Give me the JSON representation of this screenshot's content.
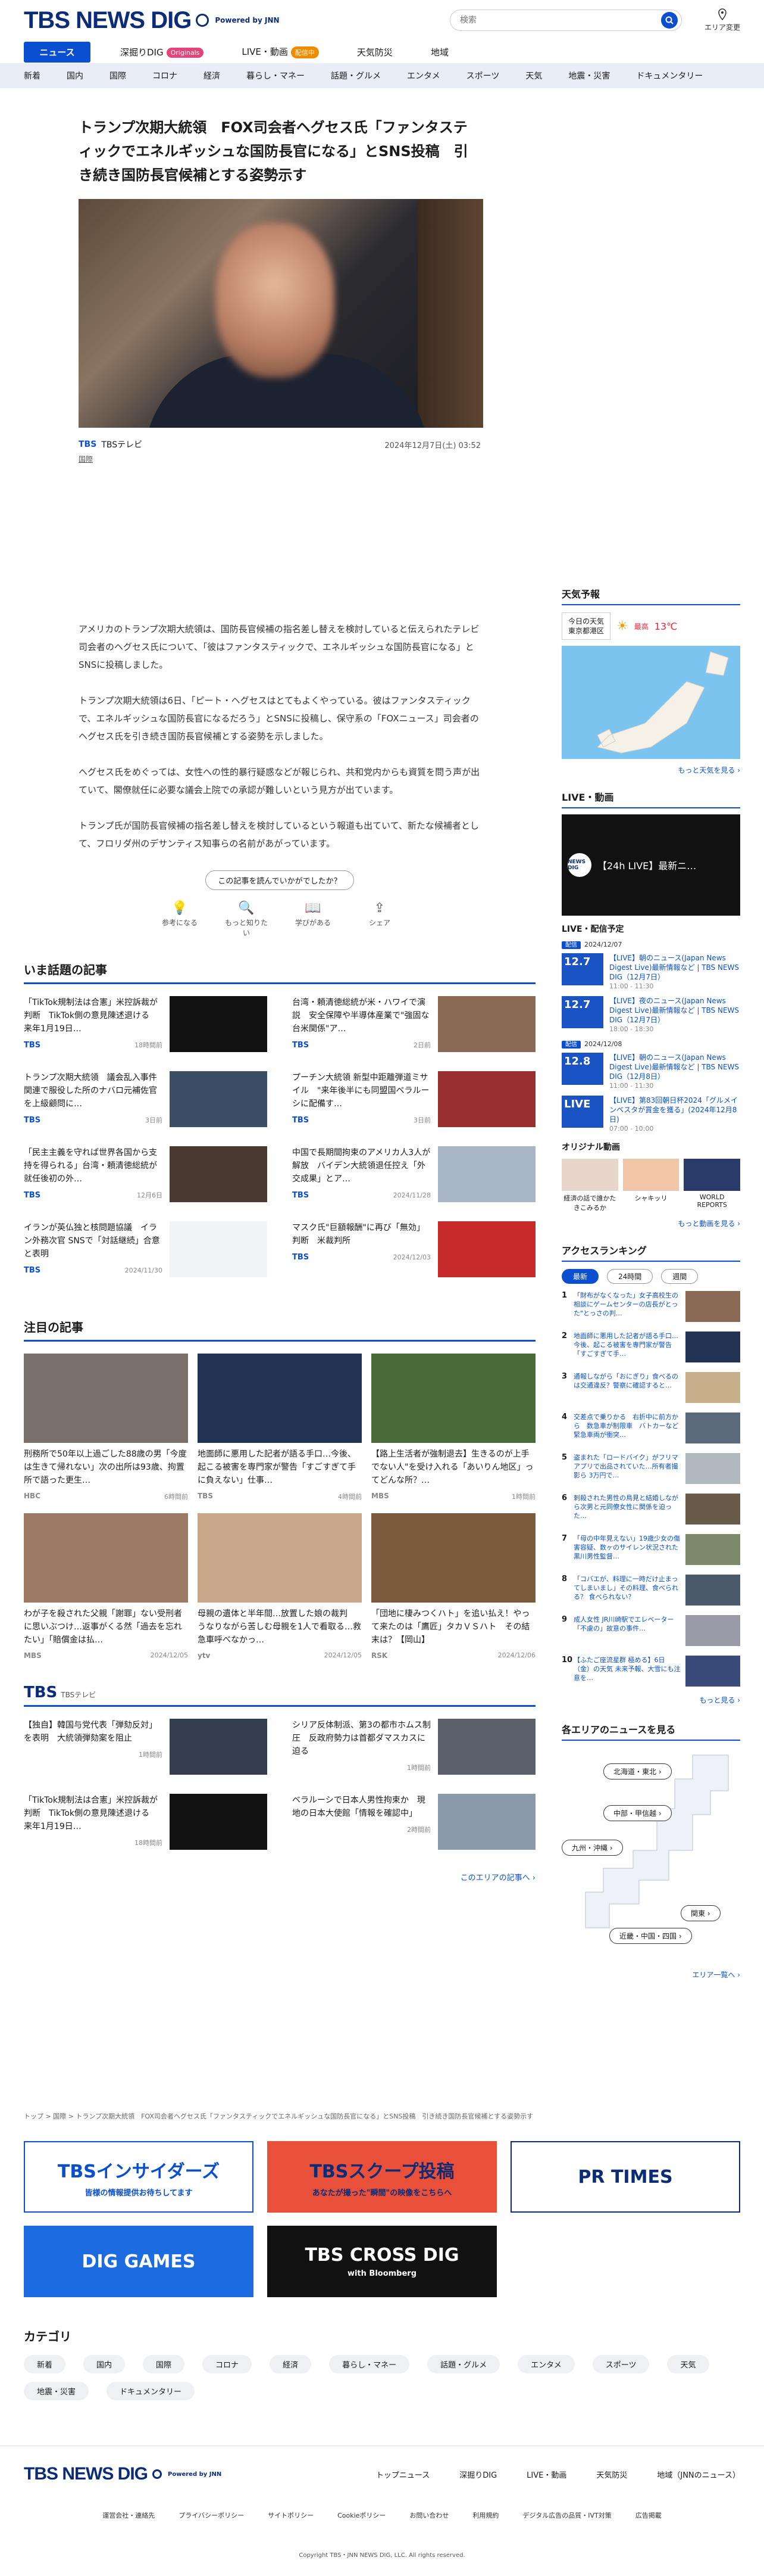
{
  "header": {
    "logo_text": "TBS NEWS DIG",
    "powered": "Powered by JNN",
    "search_placeholder": "検索",
    "area_label": "エリア変更"
  },
  "nav": [
    {
      "label": "ニュース",
      "active": true
    },
    {
      "label": "深掘りDIG",
      "badge": "Originals"
    },
    {
      "label": "LIVE・動画",
      "badge": "配信中"
    },
    {
      "label": "天気防災"
    },
    {
      "label": "地域"
    }
  ],
  "categories": [
    "新着",
    "国内",
    "国際",
    "コロナ",
    "経済",
    "暮らし・マネー",
    "話題・グルメ",
    "エンタメ",
    "スポーツ",
    "天気",
    "地震・災害",
    "ドキュメンタリー"
  ],
  "article": {
    "title": "トランプ次期大統領　FOX司会者ヘグセス氏「ファンタスティックでエネルギッシュな国防長官になる」とSNS投稿　引き続き国防長官候補とする姿勢示す",
    "source_logo": "TBS",
    "source": "TBSテレビ",
    "date": "2024年12月7日(土) 03:52",
    "tag": "国際",
    "paragraphs": [
      "アメリカのトランプ次期大統領は、国防長官候補の指名差し替えを検討していると伝えられたテレビ司会者のヘグセス氏について、「彼はファンタスティックで、エネルギッシュな国防長官になる」とSNSに投稿しました。",
      "トランプ次期大統領は6日、「ピート・ヘグセスはとてもよくやっている。彼はファンタスティックで、エネルギッシュな国防長官になるだろう」とSNSに投稿し、保守系の「FOXニュース」司会者のヘグセス氏を引き続き国防長官候補とする姿勢を示しました。",
      "ヘグセス氏をめぐっては、女性への性的暴行疑惑などが報じられ、共和党内からも資質を問う声が出ていて、閣僚就任に必要な議会上院での承認が難しいという見方が出ています。",
      "トランプ氏が国防長官候補の指名差し替えを検討しているという報道も出ていて、新たな候補者として、フロリダ州のデサンティス知事らの名前があがっています。"
    ],
    "feedback_prompt": "この記事を読んでいかがでしたか？",
    "reactions": [
      "参考になる",
      "もっと知りたい",
      "学びがある",
      "シェア"
    ]
  },
  "trending": {
    "title": "いま話題の記事",
    "items": [
      {
        "text": "「TikTok規制法は合憲」米控訴裁が判断　TikTok側の意見陳述退ける　来年1月19日…",
        "src": "TBS",
        "time": "18時間前",
        "color": "#111111"
      },
      {
        "text": "台湾・頼清徳総統が米・ハワイで演説　安全保障や半導体産業で\"強固な台米関係\"ア…",
        "src": "TBS",
        "time": "2日前",
        "color": "#8a6a55"
      },
      {
        "text": "トランプ次期大統領　議会乱入事件関連で服役した所のナバロ元補佐官を上級顧問に…",
        "src": "TBS",
        "time": "3日前",
        "color": "#3c4d66"
      },
      {
        "text": "プーチン大統領 新型中距離弾道ミサイル　\"来年後半にも同盟国ベラルーシに配備す…",
        "src": "TBS",
        "time": "3日前",
        "color": "#9a2f2f"
      },
      {
        "text": "「民主主義を守れば世界各国から支持を得られる」台湾・頼清徳総統が就任後初の外…",
        "src": "TBS",
        "time": "12月6日",
        "color": "#4a3a32"
      },
      {
        "text": "中国で長期間拘束のアメリカ人3人が解放　バイデン大統領退任控え「外交成果」とア…",
        "src": "TBS",
        "time": "2024/11/28",
        "color": "#a8b6c6"
      },
      {
        "text": "イランが英仏独と核問題協議　イラン外務次官 SNSで「対話継続」合意と表明",
        "src": "TBS",
        "time": "2024/11/30",
        "color": "#f2f4f8"
      },
      {
        "text": "マスク氏\"巨額報酬\"に再び「無効」判断　米裁判所",
        "src": "TBS",
        "time": "2024/12/03",
        "color": "#c62a2a"
      }
    ]
  },
  "featured": {
    "title": "注目の記事",
    "items": [
      {
        "text": "刑務所で50年以上過ごした88歳の男「今度は生きて帰れない」次の出所は93歳、拘置所で語った更生…",
        "src": "HBC",
        "time": "6時間前",
        "color": "#7a6f6a"
      },
      {
        "text": "地面師に悪用した記者が語る手口…今後、起こる被害を専門家が警告「すごすぎて手に負えない」仕事…",
        "src": "TBS",
        "time": "4時間前",
        "color": "#223355"
      },
      {
        "text": "【路上生活者が強制退去】生きるのが上手でない人\"を受け入れる「あいりん地区」ってどんな所？…",
        "src": "MBS",
        "time": "1時間前",
        "color": "#4b6a3a"
      },
      {
        "text": "わが子を殺された父親「謝罪」ない受刑者に思いぶつけ…返事がくる然「過去を忘れたい」「賠償金は払…",
        "src": "MBS",
        "time": "2024/12/05",
        "color": "#9c7a66"
      },
      {
        "text": "母親の遺体と半年間…放置した娘の裁判　うなりながら苦しむ母親を1人で看取る…救急車呼べなかっ…",
        "src": "ytv",
        "time": "2024/12/05",
        "color": "#c9a78a"
      },
      {
        "text": "「団地に棲みつくハト」を追い払え！やって来たのは「鷹匠」タカＶＳハト　その結末は？【岡山】",
        "src": "RSK",
        "time": "2024/12/06",
        "color": "#7a5a3a"
      }
    ]
  },
  "tbs_section": {
    "title": "TBS",
    "subtitle": "TBSテレビ",
    "items": [
      {
        "text": "【独自】韓国与党代表「弾劾反対」を表明　大統領弾劾案を阻止",
        "src": "",
        "time": "1時間前",
        "color": "#333d4d"
      },
      {
        "text": "シリア反体制派、第3の都市ホムス制圧　反政府勢力は首都ダマスカスに迫る",
        "src": "",
        "time": "1時間前",
        "color": "#5a5f6b"
      },
      {
        "text": "「TikTok規制法は合憲」米控訴裁が判断　TikTok側の意見陳述退ける　来年1月19日…",
        "src": "",
        "time": "18時間前",
        "color": "#111111"
      },
      {
        "text": "ベラルーシで日本人男性拘束か　現地の日本大使館「情報を確認中」",
        "src": "",
        "time": "2時間前",
        "color": "#8a9aaa"
      }
    ],
    "more": "このエリアの記事へ ›"
  },
  "sidebar": {
    "weather": {
      "title": "天気予報",
      "today_label": "今日の天気",
      "location": "東京都港区",
      "high_label": "最高",
      "high": "13℃",
      "more": "もっと天気を見る ›"
    },
    "live": {
      "title": "LIVE・動画",
      "video_title": "【24h LIVE】最新ニ…",
      "schedule_title": "LIVE・配信予定",
      "schedule": [
        {
          "date_badge": "配信",
          "date": "2024/12/07",
          "day": "12.7",
          "text": "【LIVE】朝のニュース(Japan News Digest Live)最新情報など | TBS NEWS DIG（12月7日）",
          "time": "11:00 - 11:30"
        },
        {
          "date_badge": "",
          "date": "",
          "day": "12.7",
          "text": "【LIVE】夜のニュース(Japan News Digest Live)最新情報など | TBS NEWS DIG（12月7日）",
          "time": "18:00 - 18:30"
        },
        {
          "date_badge": "配信",
          "date": "2024/12/08",
          "day": "12.8",
          "text": "【LIVE】朝のニュース(Japan News Digest Live)最新情報など | TBS NEWS DIG（12月8日）",
          "time": "11:00 - 11:30"
        },
        {
          "date_badge": "",
          "date": "",
          "day": "LIVE",
          "text": "【LIVE】第83回朝日杯2024「グルメインベスタが賞金を獲る」(2024年12月8日)",
          "time": "07:00 - 10:00"
        }
      ],
      "originals_title": "オリジナル動画",
      "originals": [
        "経済の話で誰かたきこみるか",
        "シャキッリ",
        "WORLD REPORTS"
      ],
      "more": "もっと動画を見る ›"
    },
    "ranking": {
      "title": "アクセスランキング",
      "tabs": [
        "最新",
        "24時間",
        "週間"
      ],
      "items": [
        "「財布がなくなった」女子高校生の相談にゲームセンターの店長がとった\"とっさの判…",
        "地面師に悪用した記者が語る手口…今後、起こる被害を専門家が警告「すごすぎて手…",
        "通報しながら「おにぎり」食べるのは交通違反？警察に確認すると…",
        "交差点で乗りかる　右折中に前方から　数急車が制限車　バトカーなど緊急車両が衝突…",
        "盗まれた「ロードバイク」がフリマアプリで出品されていた…所有者撮影ら 3万円で…",
        "刺殺された男性の鳥見と結婚しながら次男と元同僚女性に関係を迫った…",
        "「母の中年見えない」19歳少女の傷害容疑、数ヶのサイレン状況された　黒川男性監督…",
        "「コバエが、料理に一時だけ止まってしまいまし」その料理、食べられる？ 食べられない？",
        "成人女性 JR川崎駅でエレベーター「不慮の」故意の事件…",
        "【ふたご座流星群 極める】6日（金）の天気 未来予報、大雪にも注意を…"
      ],
      "more": "もっと見る ›"
    },
    "area": {
      "title": "各エリアのニュースを見る",
      "pills": [
        "北海道・東北 ›",
        "中部・甲信越 ›",
        "九州・沖縄 ›",
        "関東 ›",
        "近畿・中国・四国 ›"
      ],
      "more": "エリア一覧へ ›"
    }
  },
  "breadcrumb": "トップ > 国際 > トランプ次期大統領　FOX司会者ヘグセス氏「ファンタスティックでエネルギッシュな国防長官になる」とSNS投稿　引き続き国防長官候補とする姿勢示す",
  "banners": [
    {
      "label": "TBSインサイダーズ",
      "sub": "皆様の情報提供お待ちしてます",
      "bg": "#ffffff",
      "fg": "#0a4fd0"
    },
    {
      "label": "TBSスクープ投稿",
      "sub": "あなたが撮った\"瞬間\"の映像をこちらへ",
      "bg": "#e8503a",
      "fg": "#0c2c78"
    },
    {
      "label": "PR TIMES",
      "sub": "",
      "bg": "#ffffff",
      "fg": "#0c2c78"
    },
    {
      "label": "DIG GAMES",
      "sub": "",
      "bg": "#1d6be0",
      "fg": "#ffffff"
    },
    {
      "label": "TBS CROSS DIG",
      "sub": "with Bloomberg",
      "bg": "#111111",
      "fg": "#ffffff"
    }
  ],
  "category_section": {
    "title": "カテゴリ",
    "items": [
      "新着",
      "国内",
      "国際",
      "コロナ",
      "経済",
      "暮らし・マネー",
      "話題・グルメ",
      "エンタメ",
      "スポーツ",
      "天気",
      "地震・災害",
      "ドキュメンタリー"
    ]
  },
  "footer": {
    "nav": [
      "トップニュース",
      "深掘りDIG",
      "LIVE・動画",
      "天気防災",
      "地域（JNNのニュース）"
    ],
    "links": [
      "運営会社・連絡先",
      "プライバシーポリシー",
      "サイトポリシー",
      "Cookieポリシー",
      "お問い合わせ",
      "利用規約",
      "デジタル広告の品質・IVT対策",
      "広告掲載"
    ],
    "copyright": "Copyright TBS・JNN NEWS DIG, LLC. All rights reserved."
  }
}
